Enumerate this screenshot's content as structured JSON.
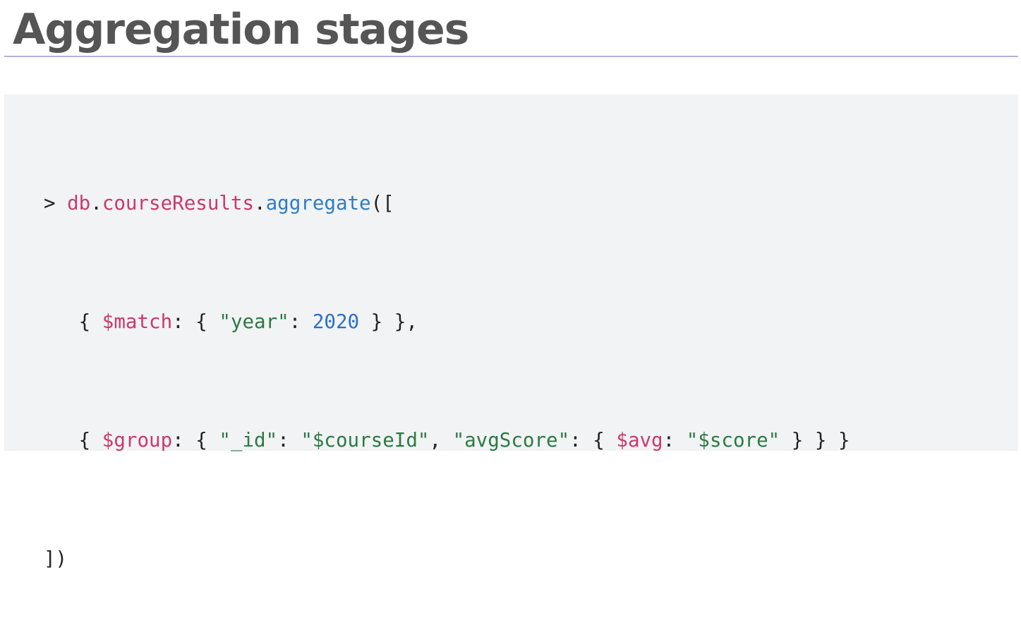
{
  "slide": {
    "title": "Aggregation stages"
  },
  "code": {
    "line1": {
      "prompt": ">",
      "db": "db",
      "dot1": ".",
      "collection": "courseResults",
      "dot2": ".",
      "method": "aggregate",
      "open": "(["
    },
    "line2": {
      "brace_open": "{",
      "op": "$match",
      "colon1": ":",
      "inner_open": "{",
      "key": "\"year\"",
      "colon2": ":",
      "value": "2020",
      "inner_close": "}",
      "close": "},"
    },
    "line3": {
      "brace_open": "{",
      "op": "$group",
      "colon1": ":",
      "inner_open": "{",
      "key1": "\"_id\"",
      "colon2": ":",
      "value1": "\"$courseId\"",
      "comma": ",",
      "key2": "\"avgScore\"",
      "colon3": ":",
      "avg_open": "{",
      "avg_op": "$avg",
      "colon4": ":",
      "avg_value": "\"$score\"",
      "avg_close": "}",
      "inner_close": "}",
      "close": "}"
    },
    "line4": {
      "close": "])"
    }
  }
}
